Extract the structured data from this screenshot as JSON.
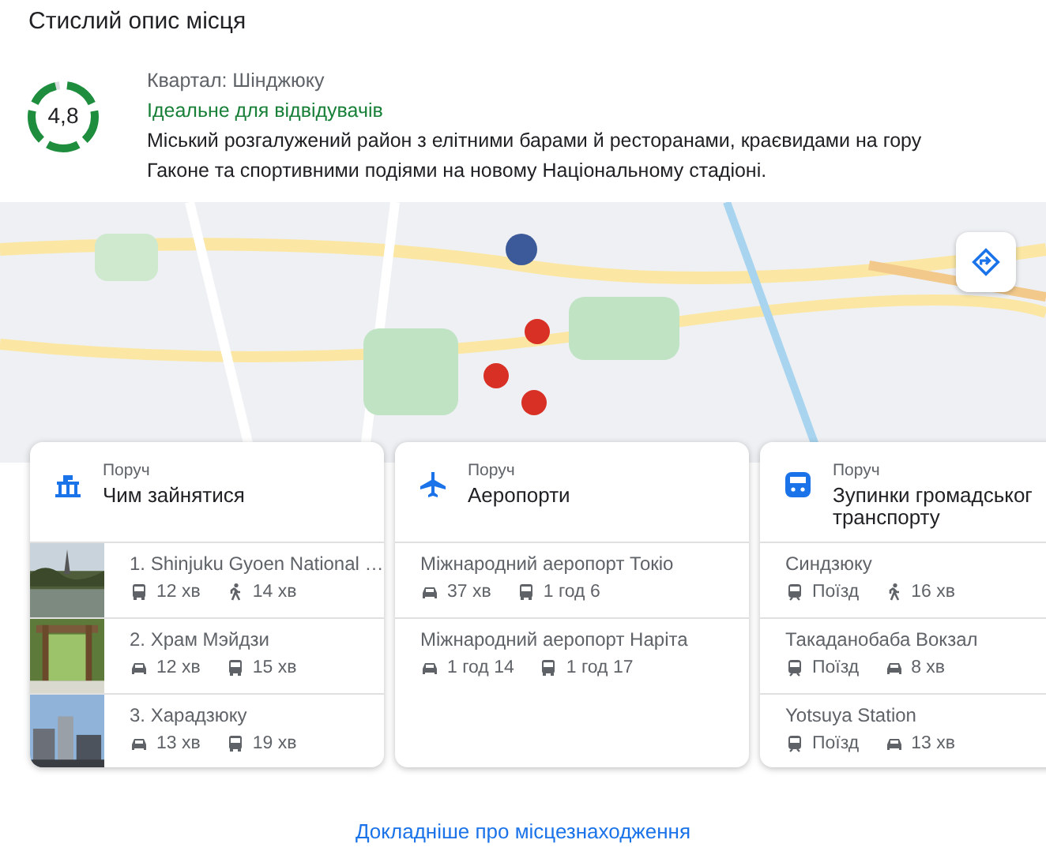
{
  "title": "Стислий опис місця",
  "summary": {
    "rating": "4,8",
    "level": 0.96,
    "district": "Квартал: Шінджюку",
    "tagline": "Ідеальне для відвідувачів",
    "description": "Міський розгалужений район з елітними барами й ресторанами, краєвидами на гору Гаконе та спортивними подіями на новому Національному стадіоні."
  },
  "cards": [
    {
      "kind": "attractions",
      "eyebrow": "Поруч",
      "title": "Чим зайнятися",
      "items": [
        {
          "name": "1. Shinjuku Gyoen National …",
          "modes": [
            {
              "kind": "bus",
              "time": "12 хв"
            },
            {
              "kind": "walk",
              "time": "14 хв"
            }
          ]
        },
        {
          "name": "2. Храм Мэйдзи",
          "modes": [
            {
              "kind": "car",
              "time": "12 хв"
            },
            {
              "kind": "bus",
              "time": "15 хв"
            }
          ]
        },
        {
          "name": "3. Харадзюку",
          "modes": [
            {
              "kind": "car",
              "time": "13 хв"
            },
            {
              "kind": "bus",
              "time": "19 хв"
            }
          ]
        }
      ]
    },
    {
      "kind": "airports",
      "eyebrow": "Поруч",
      "title": "Аеропорти",
      "items": [
        {
          "name": "Міжнародний аеропорт Токіо",
          "modes": [
            {
              "kind": "car",
              "time": "37 хв"
            },
            {
              "kind": "bus",
              "time": "1 год 6"
            }
          ]
        },
        {
          "name": "Міжнародний аеропорт Наріта",
          "modes": [
            {
              "kind": "car",
              "time": "1 год 14"
            },
            {
              "kind": "bus",
              "time": "1 год 17"
            }
          ]
        }
      ]
    },
    {
      "kind": "transit",
      "eyebrow": "Поруч",
      "title": "Зупинки громадськог транспорту",
      "items": [
        {
          "name": "Синдзюку",
          "modes": [
            {
              "kind": "train",
              "time": "Поїзд"
            },
            {
              "kind": "walk",
              "time": "16 хв"
            }
          ]
        },
        {
          "name": "Такаданобаба Вокзал",
          "modes": [
            {
              "kind": "train",
              "time": "Поїзд"
            },
            {
              "kind": "car",
              "time": "8 хв"
            }
          ]
        },
        {
          "name": "Yotsuya Station",
          "modes": [
            {
              "kind": "train",
              "time": "Поїзд"
            },
            {
              "kind": "car",
              "time": "13 хв"
            }
          ]
        }
      ]
    }
  ],
  "more_link": "Докладніше про місцезнаходження"
}
